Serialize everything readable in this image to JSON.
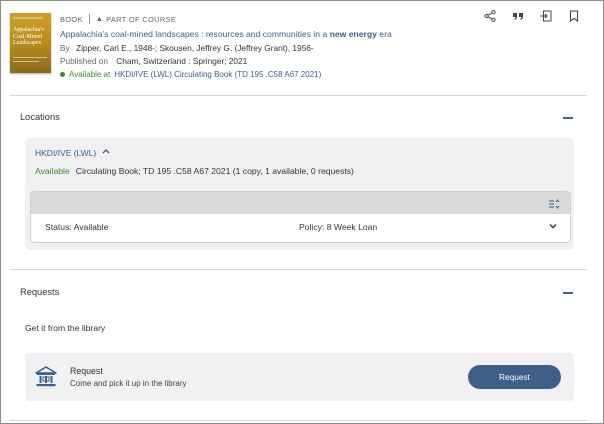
{
  "record": {
    "cover_text": "Appalachia's Coal-Mined Landscapes",
    "type_label": "BOOK",
    "course_label": "PART OF COURSE",
    "title_prefix": "Appalachia's coal-mined landscapes : resources and communities in a ",
    "title_highlight": "new energy",
    "title_suffix": " era",
    "by_label": "By",
    "authors": "Zipper, Carl E., 1948-; Skousen, Jeffrey G. (Jeffrey Grant), 1956-",
    "published_label": "Published on",
    "published": "Cham, Switzerland : Springer; 2021",
    "availability_label": "Available at",
    "availability_location": "HKDI/IVE (LWL) Circulating Book (TD 195 .C58 A67 2021)",
    "availability_color": "#3c8a2e"
  },
  "actions": {
    "share_icon": "share-icon",
    "cite_icon": "quote-icon",
    "export_icon": "send-to-icon",
    "bookmark_icon": "bookmark-icon"
  },
  "locations": {
    "heading": "Locations",
    "library": "HKDI/IVE (LWL)",
    "status": "Available",
    "holding": "Circulating Book;  TD 195 .C58 A67 2021  (1 copy, 1 available, 0 requests)",
    "item": {
      "status": "Status: Available",
      "policy": "Policy: 8 Week Loan"
    }
  },
  "requests": {
    "heading": "Requests",
    "get_it": "Get it from the library",
    "request_title": "Request",
    "request_sub": "Come and pick it up in the library",
    "request_button": "Request"
  },
  "colors": {
    "accent": "#3e5f8a",
    "available": "#3c8a2e",
    "panel": "#f1f1f4"
  }
}
